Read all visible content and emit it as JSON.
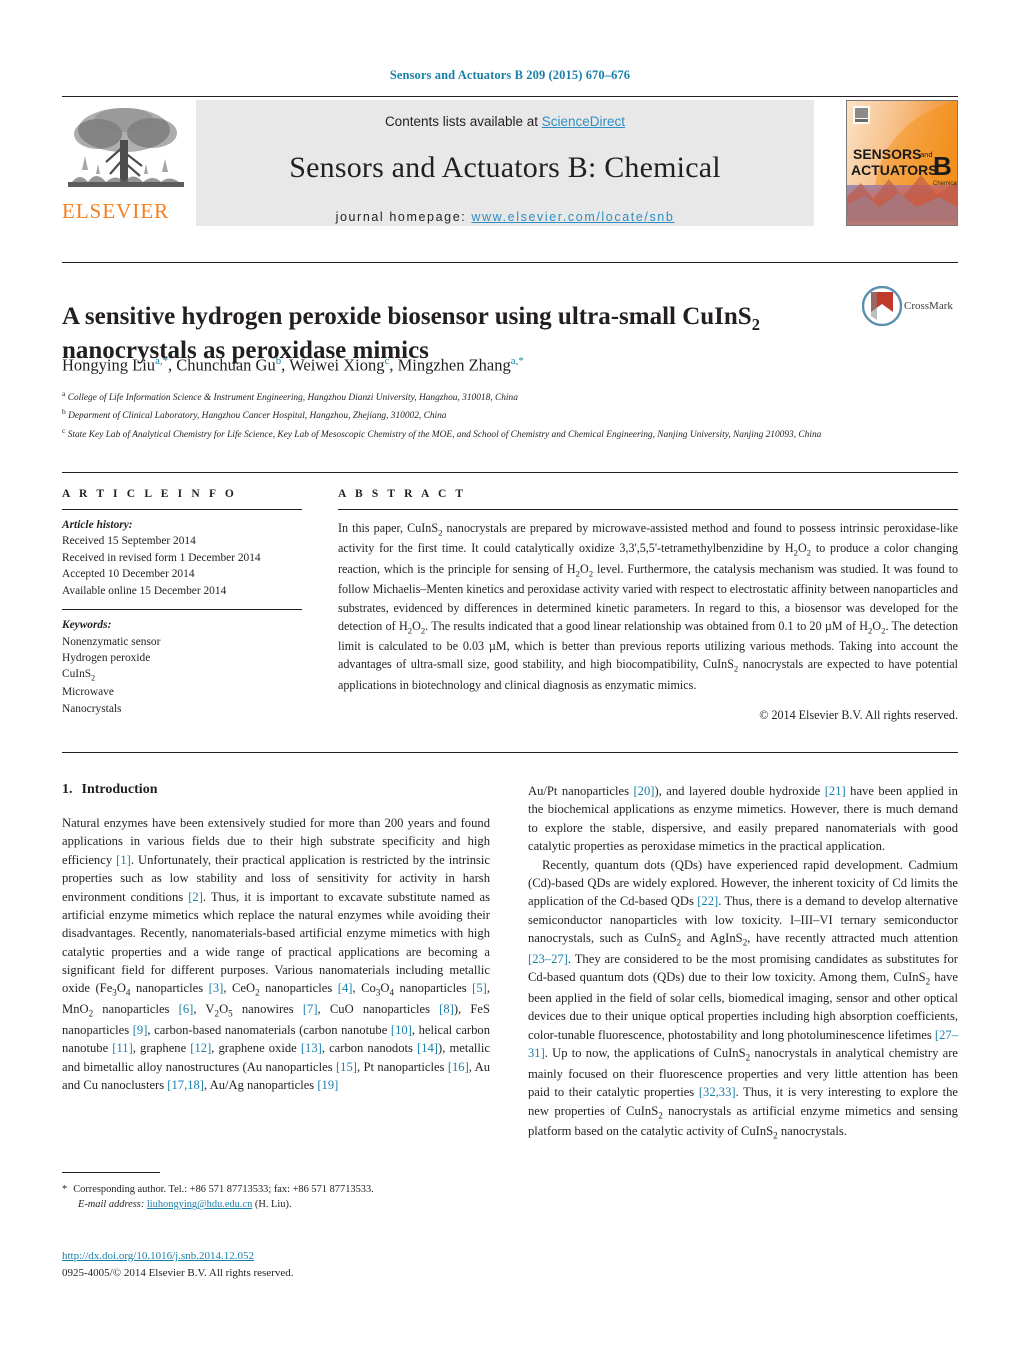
{
  "running_head": "Sensors and Actuators B 209 (2015) 670–676",
  "masthead": {
    "contents_prefix": "Contents lists available at ",
    "sciencedirect": "ScienceDirect",
    "journal_title": "Sensors and Actuators B: Chemical",
    "homepage_label": "journal homepage:",
    "homepage_url": "www.elsevier.com/locate/snb",
    "publisher": "ELSEVIER",
    "cover_line1": "SENSORS",
    "cover_and": "and",
    "cover_line2": "ACTUATORS",
    "cover_letter": "B",
    "cover_sub": "Chemical"
  },
  "crossmark": {
    "label": "CrossMark"
  },
  "article": {
    "title_line1_a": "A sensitive hydrogen peroxide biosensor using ultra-small CuInS",
    "title_line1_sub": "2",
    "title_line2": "nanocrystals as peroxidase mimics",
    "authors": [
      {
        "name": "Hongying Liu",
        "sup": "a,*"
      },
      {
        "name": "Chunchuan Gu",
        "sup": "b"
      },
      {
        "name": "Weiwei Xiong",
        "sup": "c"
      },
      {
        "name": "Mingzhen Zhang",
        "sup": "a,*"
      }
    ],
    "affiliations": [
      {
        "mark": "a",
        "text": "College of Life Information Science & Instrument Engineering, Hangzhou Dianzi University, Hangzhou, 310018, China"
      },
      {
        "mark": "b",
        "text": "Deparment of Clinical Laboratory, Hangzhou Cancer Hospital, Hangzhou, Zhejiang, 310002, China"
      },
      {
        "mark": "c",
        "text": "State Key Lab of Analytical Chemistry for Life Science, Key Lab of Mesoscopic Chemistry of the MOE, and School of Chemistry and Chemical Engineering, Nanjing University, Nanjing 210093, China"
      }
    ]
  },
  "article_info": {
    "heading": "A R T I C L E   I N F O",
    "history_label": "Article history:",
    "history": [
      "Received 15 September 2014",
      "Received in revised form 1 December 2014",
      "Accepted 10 December 2014",
      "Available online 15 December 2014"
    ],
    "keywords_label": "Keywords:",
    "keywords": [
      "Nonenzymatic sensor",
      "Hydrogen peroxide",
      "CuInS2",
      "Microwave",
      "Nanocrystals"
    ]
  },
  "abstract": {
    "heading": "A B S T R A C T",
    "text": "In this paper, CuInS2 nanocrystals are prepared by microwave-assisted method and found to possess intrinsic peroxidase-like activity for the first time. It could catalytically oxidize 3,3',5,5'-tetramethylbenzidine by H2O2 to produce a color changing reaction, which is the principle for sensing of H2O2 level. Furthermore, the catalysis mechanism was studied. It was found to follow Michaelis–Menten kinetics and peroxidase activity varied with respect to electrostatic affinity between nanoparticles and substrates, evidenced by differences in determined kinetic parameters. In regard to this, a biosensor was developed for the detection of H2O2. The results indicated that a good linear relationship was obtained from 0.1 to 20 µM of H2O2. The detection limit is calculated to be 0.03 µM, which is better than previous reports utilizing various methods. Taking into account the advantages of ultra-small size, good stability, and high biocompatibility, CuInS2 nanocrystals are expected to have potential applications in biotechnology and clinical diagnosis as enzymatic mimics.",
    "copyright": "© 2014 Elsevier B.V. All rights reserved."
  },
  "introduction": {
    "number": "1.",
    "heading": "Introduction",
    "left_paragraph_1": "Natural enzymes have been extensively studied for more than 200 years and found applications in various fields due to their high substrate specificity and high efficiency [1]. Unfortunately, their practical application is restricted by the intrinsic properties such as low stability and loss of sensitivity for activity in harsh environment conditions [2]. Thus, it is important to excavate substitute named as artificial enzyme mimetics which replace the natural enzymes while avoiding their disadvantages. Recently, nanomaterials-based artificial enzyme mimetics with high catalytic properties and a wide range of practical applications are becoming a significant field for different purposes. Various nanomaterials including metallic oxide (Fe3O4 nanoparticles [3], CeO2 nanoparticles [4], Co3O4 nanoparticles [5], MnO2 nanoparticles [6], V2O5 nanowires [7], CuO nanoparticles [8]), FeS nanoparticles [9], carbon-based nanomaterials (carbon nanotube [10], helical carbon nanotube [11], graphene [12], graphene oxide [13], carbon nanodots [14]), metallic and bimetallic alloy nanostructures (Au nanoparticles [15], Pt nanoparticles [16], Au and Cu nanoclusters [17,18], Au/Ag nanoparticles [19]",
    "right_paragraph_1": "Au/Pt nanoparticles [20]), and layered double hydroxide [21] have been applied in the biochemical applications as enzyme mimetics. However, there is much demand to explore the stable, dispersive, and easily prepared nanomaterials with good catalytic properties as peroxidase mimetics in the practical application.",
    "right_paragraph_2": "Recently, quantum dots (QDs) have experienced rapid development. Cadmium (Cd)-based QDs are widely explored. However, the inherent toxicity of Cd limits the application of the Cd-based QDs [22]. Thus, there is a demand to develop alternative semiconductor nanoparticles with low toxicity. I–III–VI ternary semiconductor nanocrystals, such as CuInS2 and AgInS2, have recently attracted much attention [23–27]. They are considered to be the most promising candidates as substitutes for Cd-based quantum dots (QDs) due to their low toxicity. Among them, CuInS2 have been applied in the field of solar cells, biomedical imaging, sensor and other optical devices due to their unique optical properties including high absorption coefficients, color-tunable fluorescence, photostability and long photoluminescence lifetimes [27–31]. Up to now, the applications of CuInS2 nanocrystals in analytical chemistry are mainly focused on their fluorescence properties and very little attention has been paid to their catalytic properties [32,33]. Thus, it is very interesting to explore the new properties of CuInS2 nanocrystals as artificial enzyme mimetics and sensing platform based on the catalytic activity of CuInS2 nanocrystals."
  },
  "footnote": {
    "star": "*",
    "corresponding": "Corresponding author. Tel.: +86 571 87713533; fax: +86 571 87713533.",
    "email_label": "E-mail address:",
    "email": "liuhongying@hdu.edu.cn",
    "email_owner": "(H. Liu)."
  },
  "footer": {
    "doi": "http://dx.doi.org/10.1016/j.snb.2014.12.052",
    "issn_line": "0925-4005/© 2014 Elsevier B.V. All rights reserved."
  },
  "colors": {
    "link_blue": "#1a7fa8",
    "sciencedirect_blue": "#2f8fc4",
    "elsevier_orange": "#f08020",
    "banner_gray": "#e8e8e8"
  }
}
